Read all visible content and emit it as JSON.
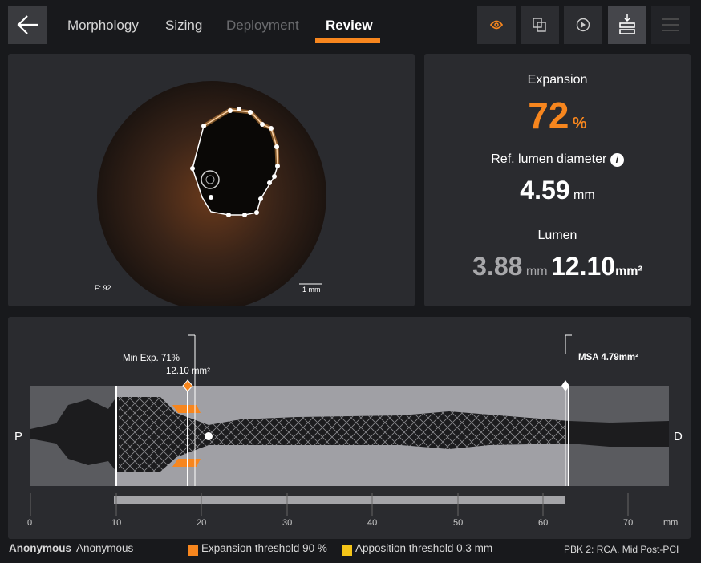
{
  "nav": {
    "back": "back",
    "tabs": [
      {
        "label": "Morphology",
        "state": "normal"
      },
      {
        "label": "Sizing",
        "state": "normal"
      },
      {
        "label": "Deployment",
        "state": "disabled"
      },
      {
        "label": "Review",
        "state": "active"
      }
    ]
  },
  "toolbar": [
    "eye-icon",
    "overlay-icon",
    "play-icon",
    "download-layers-icon",
    "menu-icon"
  ],
  "image": {
    "frame": "F: 92",
    "scale": "1 mm"
  },
  "stats": {
    "expansion_label": "Expansion",
    "expansion_value": "72",
    "expansion_unit": "%",
    "ref_label": "Ref. lumen diameter",
    "ref_value": "4.59",
    "ref_unit": "mm",
    "lumen_label": "Lumen",
    "lumen_diam": "3.88",
    "lumen_diam_unit": "mm",
    "lumen_area": "12.10",
    "lumen_area_unit": "mm²"
  },
  "longitudinal": {
    "min_exp": "Min Exp. 71%",
    "min_area": "12.10 mm²",
    "msa": "MSA 4.79mm²",
    "proximal": "P",
    "distal": "D",
    "ticks": [
      "0",
      "10",
      "20",
      "30",
      "40",
      "50",
      "60",
      "70"
    ],
    "unit": "mm"
  },
  "footer": {
    "patient_bold": "Anonymous",
    "patient": "Anonymous",
    "exp_threshold": "Expansion threshold 90 %",
    "app_threshold": "Apposition threshold  0.3 mm",
    "study": "PBK 2:  RCA,  Mid  Post-PCI"
  },
  "colors": {
    "accent": "#f7861e",
    "apposition": "#f5c518"
  }
}
